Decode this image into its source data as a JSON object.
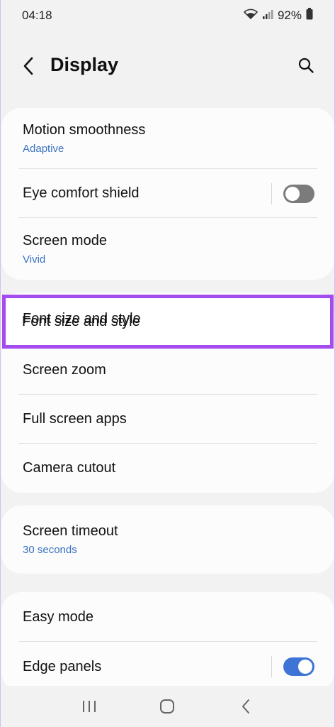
{
  "status_bar": {
    "time": "04:18",
    "battery": "92%"
  },
  "header": {
    "title": "Display",
    "icons": [
      "back-arrow-icon",
      "search-icon"
    ]
  },
  "groups": [
    {
      "items": [
        {
          "title": "Motion smoothness",
          "subtitle": "Adaptive"
        },
        {
          "title": "Eye comfort shield",
          "toggle": false
        },
        {
          "title": "Screen mode",
          "subtitle": "Vivid"
        }
      ]
    },
    {
      "items": [
        {
          "title": "Font size and style"
        },
        {
          "title": "Screen zoom"
        },
        {
          "title": "Full screen apps"
        },
        {
          "title": "Camera cutout"
        }
      ]
    },
    {
      "items": [
        {
          "title": "Screen timeout",
          "subtitle": "30 seconds"
        }
      ]
    },
    {
      "items": [
        {
          "title": "Easy mode"
        },
        {
          "title": "Edge panels",
          "toggle": true
        }
      ]
    }
  ],
  "colors": {
    "accent_text": "#3a72c2",
    "toggle_on": "#3e74d6",
    "toggle_off": "#7b7b7b",
    "highlight": "#a54cf0"
  },
  "nav_bar": {
    "icons": [
      "recent-apps-icon",
      "home-icon",
      "back-icon"
    ]
  }
}
